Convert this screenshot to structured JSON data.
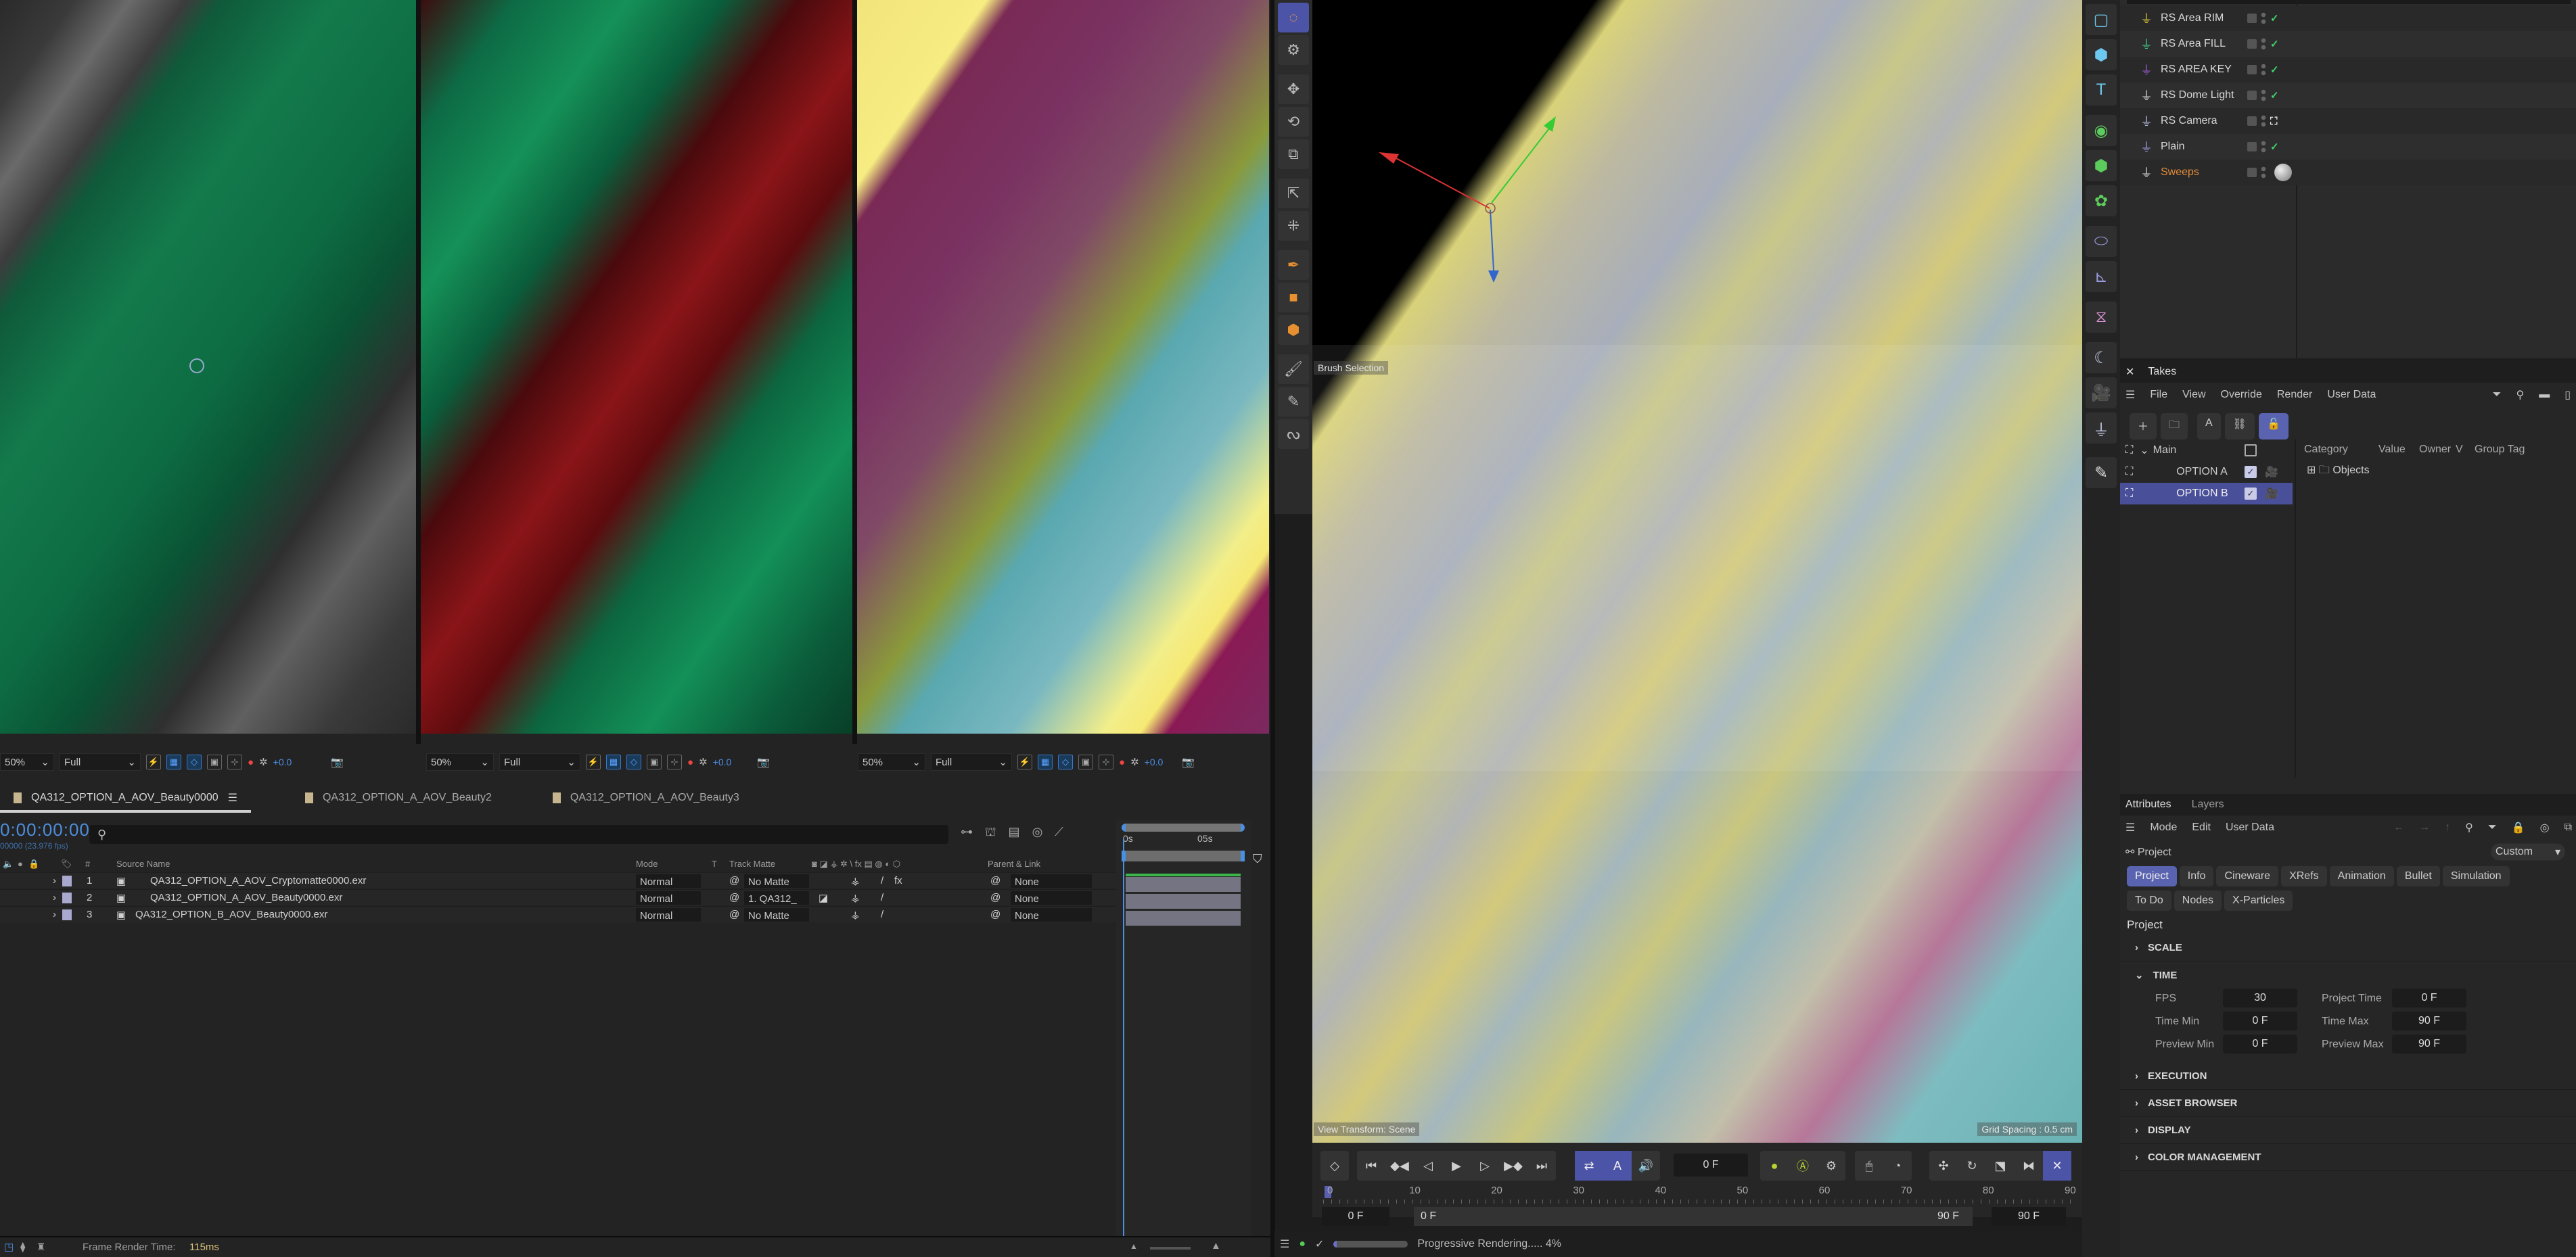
{
  "ae": {
    "viewers": [
      {
        "zoom": "50%",
        "quality": "Full",
        "exposure": "+0.0"
      },
      {
        "zoom": "50%",
        "quality": "Full",
        "exposure": "+0.0"
      },
      {
        "zoom": "50%",
        "quality": "Full",
        "exposure": "+0.0"
      }
    ],
    "comp_tabs": [
      {
        "label": "QA312_OPTION_A_AOV_Beauty0000",
        "active": true
      },
      {
        "label": "QA312_OPTION_A_AOV_Beauty2",
        "active": false
      },
      {
        "label": "QA312_OPTION_A_AOV_Beauty3",
        "active": false
      }
    ],
    "timecode": "0:00:00:00",
    "fps_label": "00000 (23.976 fps)",
    "search_placeholder": "",
    "columns": {
      "number": "#",
      "source_name": "Source Name",
      "mode": "Mode",
      "t": "T",
      "track_matte": "Track Matte",
      "parent_link": "Parent & Link"
    },
    "layers": [
      {
        "num": "1",
        "name": "QA312_OPTION_A_AOV_Cryptomatte0000.exr",
        "mode": "Normal",
        "track_matte": "No Matte",
        "parent": "None",
        "fx": "fx"
      },
      {
        "num": "2",
        "name": "QA312_OPTION_A_AOV_Beauty0000.exr",
        "mode": "Normal",
        "track_matte": "1. QA312_",
        "parent": "None",
        "fx": ""
      },
      {
        "num": "3",
        "name": "QA312_OPTION_B_AOV_Beauty0000.exr",
        "mode": "Normal",
        "track_matte": "No Matte",
        "parent": "None",
        "fx": ""
      }
    ],
    "ruler": {
      "start": "0s",
      "mark": "05s"
    },
    "status": {
      "label": "Frame Render Time:",
      "value": "115ms"
    }
  },
  "c4d": {
    "viewport": {
      "hud_brush": "Brush Selection",
      "view_transform": "View Transform: Scene",
      "grid_spacing": "Grid Spacing : 0.5 cm"
    },
    "tools": [
      "live-selection",
      "tool-settings",
      "move",
      "rotate",
      "scale",
      "move-select",
      "multi-move",
      "spline-pen",
      "polygon-pen",
      "cube-pen",
      "brush",
      "line-pen",
      "sketch"
    ],
    "transport": {
      "current_frame": "0 F",
      "ruler_ticks": [
        "0",
        "10",
        "20",
        "30",
        "40",
        "50",
        "60",
        "70",
        "80",
        "90"
      ],
      "range_start": "0 F",
      "range_inner_start": "0 F",
      "range_inner_end": "90 F",
      "range_end": "90 F"
    },
    "status": {
      "progress_label": "Progressive Rendering..... 4%",
      "progress_pct": 4
    },
    "objects": [
      {
        "name": "RS Area RIM",
        "icon_color": "#d9c23a",
        "flag": "check"
      },
      {
        "name": "RS Area FILL",
        "icon_color": "#3fd18a",
        "flag": "check"
      },
      {
        "name": "RS AREA KEY",
        "icon_color": "#9a5ad6",
        "flag": "check"
      },
      {
        "name": "RS Dome Light",
        "icon_color": "#d8d8d8",
        "flag": "check"
      },
      {
        "name": "RS Camera",
        "icon_color": "#b8c4e8",
        "flag": "target"
      },
      {
        "name": "Plain",
        "icon_color": "#9aa0e0",
        "flag": "check"
      },
      {
        "name": "Sweeps",
        "icon_color": "#d8d8d8",
        "flag": "material",
        "name_color": "#e08a3a"
      }
    ],
    "takes": {
      "title": "Takes",
      "menu": [
        "File",
        "View",
        "Override",
        "Render",
        "User Data"
      ],
      "rows": [
        {
          "label": "Main",
          "checked": false,
          "selected": false
        },
        {
          "label": "OPTION A",
          "checked": true,
          "selected": false
        },
        {
          "label": "OPTION B",
          "checked": true,
          "selected": true
        }
      ],
      "columns": [
        "Category",
        "Value",
        "Owner",
        "V",
        "Group Tag"
      ],
      "tree_root": "Objects"
    },
    "attributes": {
      "tabs": [
        "Attributes",
        "Layers"
      ],
      "menu": [
        "Mode",
        "Edit",
        "User Data"
      ],
      "object_label": "Project",
      "preset": "Custom",
      "buttons": [
        "Project",
        "Info",
        "Cineware",
        "XRefs",
        "Animation",
        "Bullet",
        "Simulation",
        "To Do",
        "Nodes",
        "X-Particles"
      ],
      "active_button": "Project",
      "section_heading": "Project",
      "sections": [
        "SCALE",
        "TIME",
        "EXECUTION",
        "ASSET BROWSER",
        "DISPLAY",
        "COLOR MANAGEMENT"
      ],
      "time": {
        "fps_label": "FPS",
        "fps": "30",
        "project_time_label": "Project Time",
        "project_time": "0 F",
        "time_min_label": "Time Min",
        "time_min": "0 F",
        "time_max_label": "Time Max",
        "time_max": "90 F",
        "preview_min_label": "Preview Min",
        "preview_min": "0 F",
        "preview_max_label": "Preview Max",
        "preview_max": "90 F"
      }
    }
  }
}
